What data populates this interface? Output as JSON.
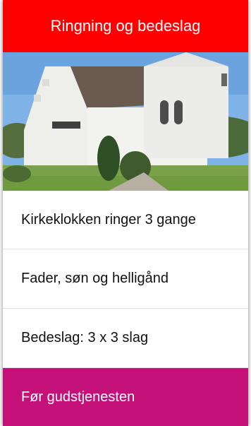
{
  "header": {
    "title": "Ringning og bedeslag"
  },
  "hero": {
    "image_subject": "church-photo"
  },
  "items": [
    {
      "label": "Kirkeklokken ringer 3 gange"
    },
    {
      "label": "Fader, søn og helligånd"
    },
    {
      "label": "Bedeslag: 3 x 3 slag"
    }
  ],
  "footer": {
    "label": "Før gudstjenesten"
  },
  "colors": {
    "header_bg": "#ff0000",
    "footer_bg": "#c4117a"
  }
}
